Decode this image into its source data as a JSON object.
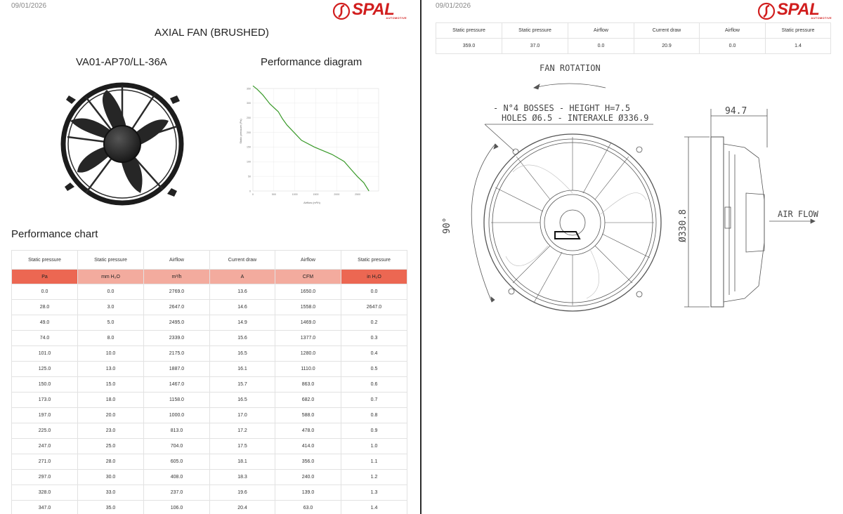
{
  "left_page": {
    "date": "09/01/2026",
    "logo": {
      "text": "SPAL",
      "sub": "AUTOMOTIVE"
    },
    "title": "AXIAL FAN (BRUSHED)",
    "model": "VA01-AP70/LL-36A",
    "diagram_title": "Performance diagram",
    "chart_title": "Performance chart",
    "table": {
      "headers": [
        "Static pressure",
        "Static pressure",
        "Airflow",
        "Current draw",
        "Airflow",
        "Static pressure"
      ],
      "units": [
        "Pa",
        "mm H₂O",
        "m³/h",
        "A",
        "CFM",
        "in H₂O"
      ],
      "rows": [
        [
          "0.0",
          "0.0",
          "2769.0",
          "13.6",
          "1650.0",
          "0.0"
        ],
        [
          "28.0",
          "3.0",
          "2647.0",
          "14.6",
          "1558.0",
          "2647.0"
        ],
        [
          "49.0",
          "5.0",
          "2495.0",
          "14.9",
          "1469.0",
          "0.2"
        ],
        [
          "74.0",
          "8.0",
          "2339.0",
          "15.6",
          "1377.0",
          "0.3"
        ],
        [
          "101.0",
          "10.0",
          "2175.0",
          "16.5",
          "1280.0",
          "0.4"
        ],
        [
          "125.0",
          "13.0",
          "1887.0",
          "16.1",
          "1110.0",
          "0.5"
        ],
        [
          "150.0",
          "15.0",
          "1467.0",
          "15.7",
          "863.0",
          "0.6"
        ],
        [
          "173.0",
          "18.0",
          "1158.0",
          "16.5",
          "682.0",
          "0.7"
        ],
        [
          "197.0",
          "20.0",
          "1000.0",
          "17.0",
          "588.0",
          "0.8"
        ],
        [
          "225.0",
          "23.0",
          "813.0",
          "17.2",
          "478.0",
          "0.9"
        ],
        [
          "247.0",
          "25.0",
          "704.0",
          "17.5",
          "414.0",
          "1.0"
        ],
        [
          "271.0",
          "28.0",
          "605.0",
          "18.1",
          "356.0",
          "1.1"
        ],
        [
          "297.0",
          "30.0",
          "408.0",
          "18.3",
          "240.0",
          "1.2"
        ],
        [
          "328.0",
          "33.0",
          "237.0",
          "19.6",
          "139.0",
          "1.3"
        ],
        [
          "347.0",
          "35.0",
          "106.0",
          "20.4",
          "63.0",
          "1.4"
        ]
      ]
    }
  },
  "right_page": {
    "date": "09/01/2026",
    "logo": {
      "text": "SPAL",
      "sub": "AUTOMOTIVE"
    },
    "table": {
      "headers": [
        "Static pressure",
        "Static pressure",
        "Airflow",
        "Current draw",
        "Airflow",
        "Static pressure"
      ],
      "row": [
        "359.0",
        "37.0",
        "0.0",
        "20.9",
        "0.0",
        "1.4"
      ]
    },
    "drawing": {
      "fan_rotation": "FAN ROTATION",
      "bosses_line1": "N°4 BOSSES - HEIGHT H=7.5",
      "bosses_line2": "HOLES Ø6.5 - INTERAXLE Ø336.9",
      "angle": "90°",
      "depth": "94.7",
      "diameter": "Ø330.8",
      "air_flow": "AIR FLOW"
    }
  },
  "chart_data": {
    "type": "line",
    "title": "",
    "xlabel": "Airflow (m³/h)",
    "ylabel": "Static pressure (Pa)",
    "xlim": [
      0,
      3000
    ],
    "ylim": [
      0,
      350
    ],
    "xticks": [
      "0",
      "500",
      "1000",
      "1500",
      "2000",
      "2500"
    ],
    "yticks": [
      "0",
      "50",
      "100",
      "150",
      "200",
      "250",
      "300",
      "350"
    ],
    "grid": true,
    "series_color": "#3a9a2a",
    "x": [
      0,
      106,
      237,
      408,
      605,
      704,
      813,
      1000,
      1158,
      1467,
      1887,
      2175,
      2339,
      2495,
      2647,
      2769
    ],
    "y": [
      359,
      347,
      328,
      297,
      271,
      247,
      225,
      197,
      173,
      150,
      125,
      101,
      74,
      49,
      28,
      0
    ]
  }
}
